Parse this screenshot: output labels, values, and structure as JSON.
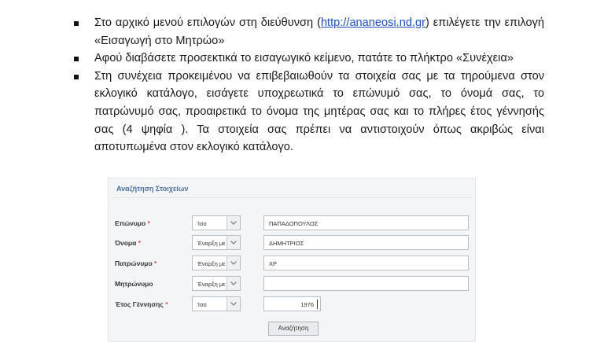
{
  "bullets": [
    {
      "text_before": "Στο αρχικό μενού επιλογών στη διεύθυνση (",
      "link": "http://ananeosi.nd.gr",
      "text_after": ") επιλέγετε την επιλογή «Εισαγωγή στο Μητρώο»"
    },
    {
      "text": "Αφού διαβάσετε προσεκτικά το εισαγωγικό κείμενο, πατάτε το πλήκτρο «Συνέχεια»"
    },
    {
      "text": "Στη συνέχεια προκειμένου να επιβεβαιωθούν τα στοιχεία σας με τα τηρούμενα στον εκλογικό κατάλογο, εισάγετε υποχρεωτικά το επώνυμό σας, το όνομά σας, το πατρώνυμό σας, προαιρετικά το όνομα της μητέρας σας και το πλήρες έτος γέννησής σας (4 ψηφία ). Τα στοιχεία σας πρέπει να αντιστοιχούν όπως ακριβώς είναι αποτυπωμένα στον εκλογικό κατάλογο."
    }
  ],
  "form": {
    "title": "Αναζήτηση Στοιχείων",
    "required_mark": "*",
    "rows": [
      {
        "label": "Επώνυμο",
        "required": true,
        "match": "Ίσο",
        "value": "ΠΑΠΑΔΟΠΟΥΛΟΣ"
      },
      {
        "label": "Όνομα",
        "required": true,
        "match": "Έναρξη με",
        "value": "ΔΗΜΗΤΡΙΟΣ"
      },
      {
        "label": "Πατρώνυμο",
        "required": true,
        "match": "Έναρξη με",
        "value": "ΧΡ"
      },
      {
        "label": "Μητρώνυμο",
        "required": false,
        "match": "Έναρξη με",
        "value": ""
      },
      {
        "label": "Έτος Γέννησης",
        "required": true,
        "match": "Ίσο",
        "value": "1976"
      }
    ],
    "search_button": "Αναζήτηση"
  }
}
